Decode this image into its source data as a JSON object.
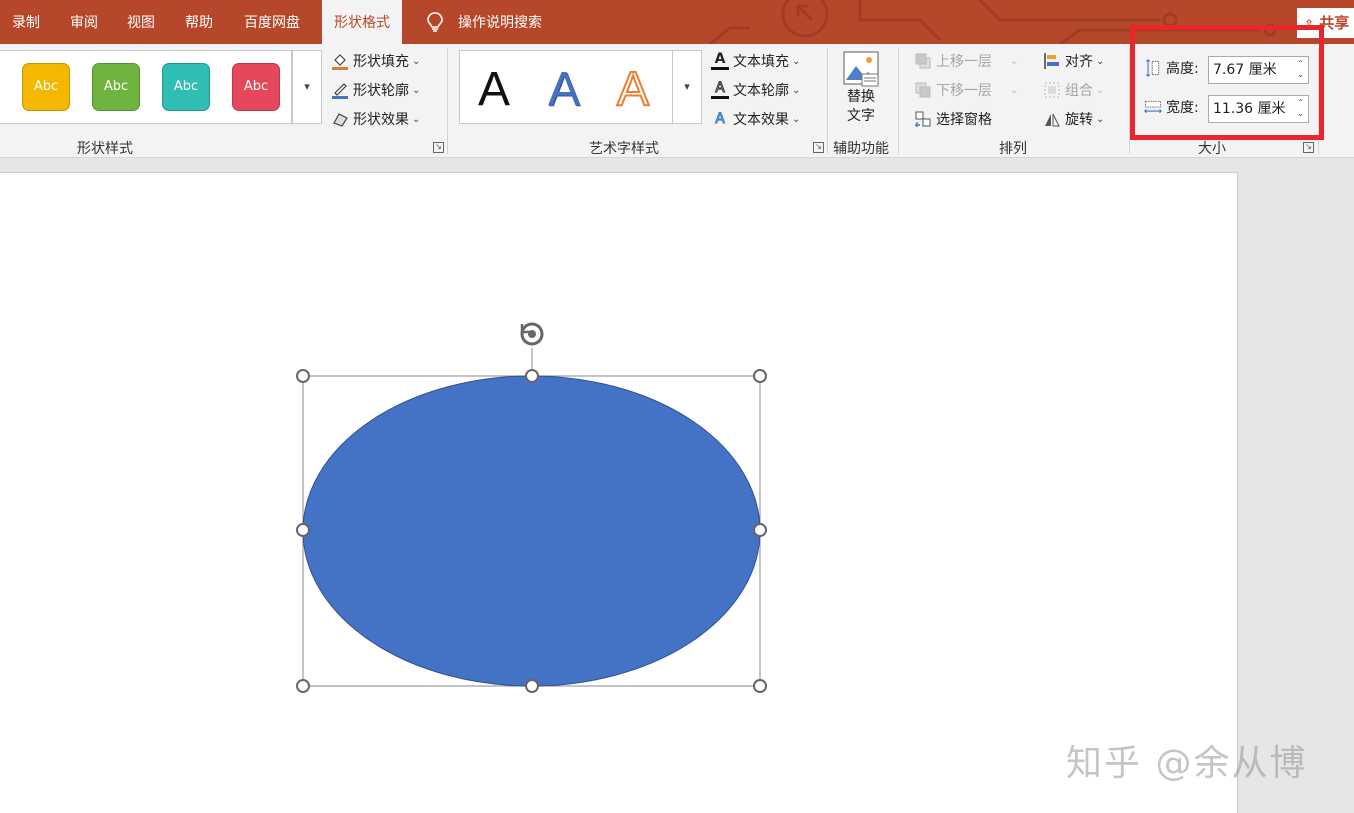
{
  "tabs": {
    "record": "录制",
    "review": "审阅",
    "view": "视图",
    "help": "帮助",
    "baidu": "百度网盘",
    "shape_format": "形状格式",
    "search": "操作说明搜索",
    "share": "共享"
  },
  "shape_styles": {
    "label": "形状样式",
    "presets": [
      {
        "text": "Abc",
        "color": "#f5b800"
      },
      {
        "text": "Abc",
        "color": "#70b440"
      },
      {
        "text": "Abc",
        "color": "#2fbdb4"
      },
      {
        "text": "Abc",
        "color": "#e4485a"
      }
    ],
    "fill": "形状填充",
    "outline": "形状轮廓",
    "effects": "形状效果"
  },
  "wordart": {
    "label": "艺术字样式",
    "samples": [
      "A",
      "A",
      "A"
    ],
    "text_fill": "文本填充",
    "text_outline": "文本轮廓",
    "text_effects": "文本效果"
  },
  "accessibility": {
    "label": "辅助功能",
    "alt_text_line1": "替换",
    "alt_text_line2": "文字"
  },
  "arrange": {
    "label": "排列",
    "bring_forward": "上移一层",
    "send_backward": "下移一层",
    "selection_pane": "选择窗格",
    "align": "对齐",
    "group": "组合",
    "rotate": "旋转"
  },
  "size": {
    "label": "大小",
    "height_label": "高度:",
    "height_value": "7.67 厘米",
    "width_label": "宽度:",
    "width_value": "11.36 厘米"
  },
  "shape": {
    "fill_color": "#4472c4",
    "outline_color": "#2f528f"
  },
  "watermark": "知乎 @余从博",
  "colors": {
    "tab_bar": "#b7472a",
    "highlight_box": "#e8262d"
  }
}
